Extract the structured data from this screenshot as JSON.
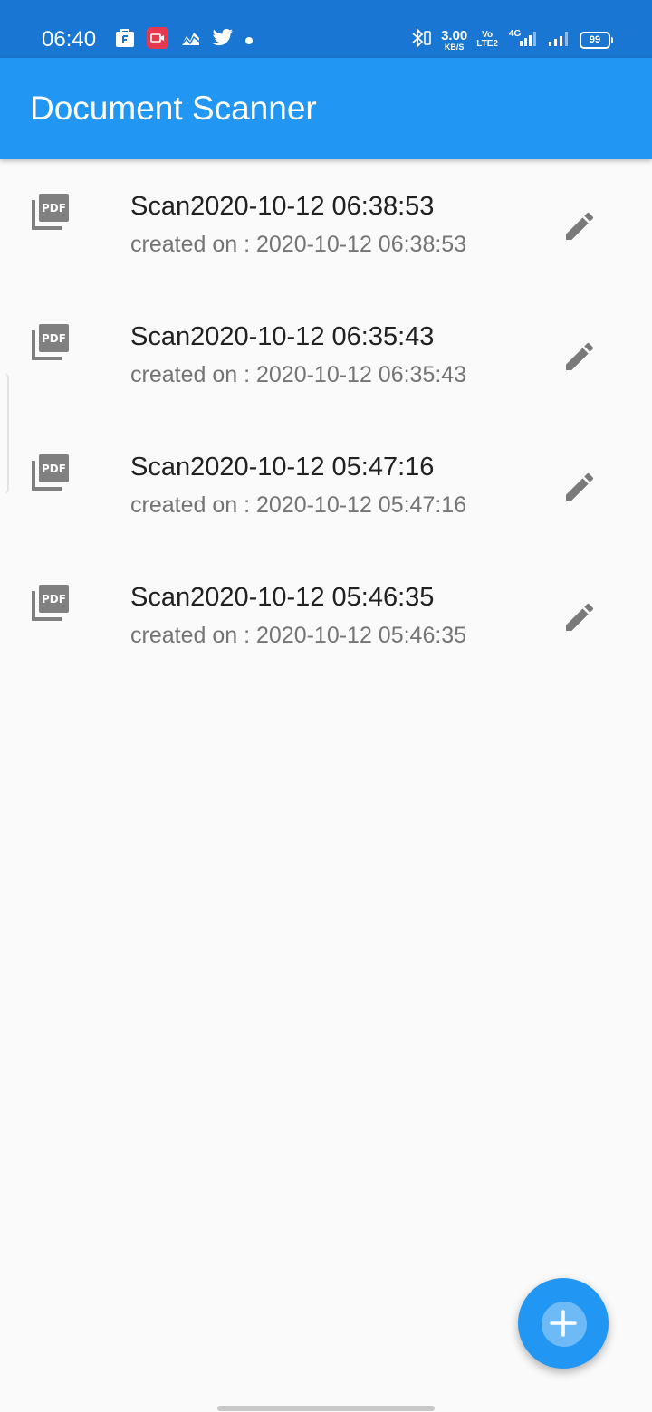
{
  "status_bar": {
    "time": "06:40",
    "left_icons": [
      "flipkart-bag-icon",
      "screen-record-icon",
      "stocks-app-icon",
      "twitter-icon",
      "notification-dot-icon"
    ],
    "network_speed": "3.00",
    "network_speed_unit": "KB/S",
    "volte_top": "Vo",
    "volte_bottom": "LTE2",
    "network_type": "4G",
    "battery_level": "99",
    "colors": {
      "background": "#1976d2",
      "foreground": "#ffffff"
    }
  },
  "app_bar": {
    "title": "Document Scanner",
    "background": "#2196f3"
  },
  "documents": [
    {
      "title": "Scan2020-10-12 06:38:53",
      "subtitle": "created on : 2020-10-12 06:38:53",
      "icon": "pdf-icon",
      "action_icon": "edit-icon"
    },
    {
      "title": "Scan2020-10-12 06:35:43",
      "subtitle": "created on : 2020-10-12 06:35:43",
      "icon": "pdf-icon",
      "action_icon": "edit-icon"
    },
    {
      "title": "Scan2020-10-12 05:47:16",
      "subtitle": "created on : 2020-10-12 05:47:16",
      "icon": "pdf-icon",
      "action_icon": "edit-icon"
    },
    {
      "title": "Scan2020-10-12 05:46:35",
      "subtitle": "created on : 2020-10-12 05:46:35",
      "icon": "pdf-icon",
      "action_icon": "edit-icon"
    }
  ],
  "fab": {
    "icon": "add-icon",
    "color": "#2196f3"
  }
}
